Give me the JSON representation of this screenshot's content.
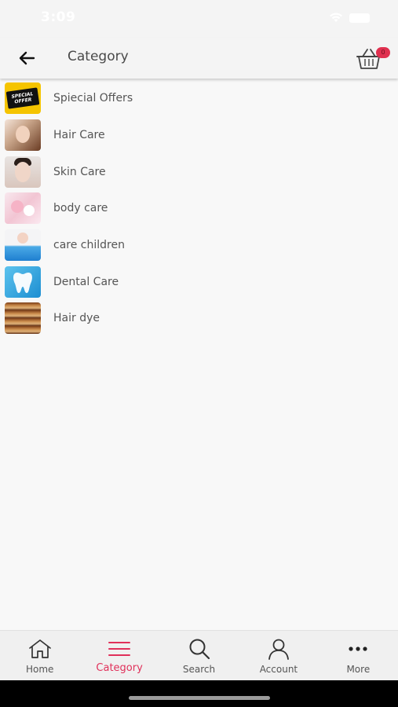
{
  "status_bar": {
    "time": "3:09"
  },
  "header": {
    "title": "Category",
    "cart_count": "0"
  },
  "categories": [
    {
      "label": "Spiecial Offers",
      "thumb_text_1": "SPECIAL",
      "thumb_text_2": "OFFER"
    },
    {
      "label": "Hair Care"
    },
    {
      "label": "Skin Care"
    },
    {
      "label": "body care"
    },
    {
      "label": "care children"
    },
    {
      "label": "Dental Care"
    },
    {
      "label": "Hair dye"
    }
  ],
  "bottom_nav": [
    {
      "label": "Home",
      "icon": "home-icon"
    },
    {
      "label": "Category",
      "icon": "menu-icon",
      "active": true
    },
    {
      "label": "Search",
      "icon": "search-icon"
    },
    {
      "label": "Account",
      "icon": "account-icon"
    },
    {
      "label": "More",
      "icon": "more-icon"
    }
  ],
  "colors": {
    "accent": "#e0305a",
    "badge": "#e0304f",
    "text": "#555555"
  }
}
